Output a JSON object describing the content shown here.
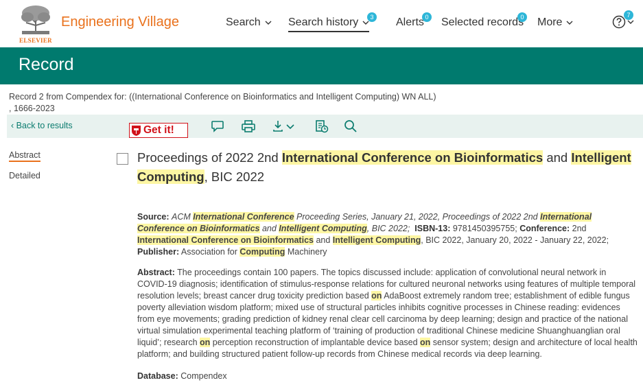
{
  "brand": {
    "logo_word": "ELSEVIER",
    "name": "Engineering Village",
    "color": "#e9711c"
  },
  "nav": {
    "search": "Search",
    "search_history": "Search history",
    "search_history_count": "3",
    "alerts": "Alerts",
    "alerts_count": "0",
    "selected_records": "Selected records",
    "selected_count": "0",
    "more": "More",
    "help_count": "7"
  },
  "band": {
    "title": "Record",
    "color": "#007a6e"
  },
  "record_info": {
    "line1": "Record 2 from Compendex for: ((International Conference on Bioinformatics and Intelligent Computing) WN ALL)",
    "line2": ", 1666-2023"
  },
  "toolbar": {
    "back": "Back to results",
    "getit": "Get it!",
    "icons": [
      "comment-icon",
      "print-icon",
      "download-icon",
      "save-to-folder-icon",
      "search-icon"
    ]
  },
  "side_tabs": {
    "abstract": "Abstract",
    "detailed": "Detailed"
  },
  "title_parts": {
    "t1": "Proceedings of 2022 2nd ",
    "t2": "International Conference on Bioinformatics",
    "t3": " and ",
    "t4": "Intelligent Computing",
    "t5": ", BIC 2022"
  },
  "source": {
    "label_source": "Source:",
    "s1": "ACM ",
    "s2": "International Conference",
    "s3": " Proceeding Series, January 21, 2022, ",
    "s4": "Proceedings of 2022 2nd ",
    "s5": "International Conference on Bioinformatics",
    "s6": " and ",
    "s7": "Intelligent Computing",
    "s8": ", BIC 2022;",
    "label_isbn": "ISBN-13:",
    "isbn": "9781450395755;",
    "label_conference": "Conference:",
    "c1": "2nd ",
    "c2": "International Conference on Bioinformatics",
    "c3": " and ",
    "c4": "Intelligent Computing",
    "c5": ", BIC 2022, January 20, 2022 - January 22, 2022;",
    "label_publisher": "Publisher:",
    "p1": "Association for ",
    "p2": "Computing",
    "p3": " Machinery"
  },
  "abstract": {
    "label": "Abstract:",
    "a1": "The proceedings contain 100 papers. The topics discussed include: application of convolutional neural network in COVID-19 diagnosis; identification of stimulus-response relations for cultured neuronal networks using features of multiple temporal resolution levels; breast cancer drug toxicity prediction based ",
    "on1": "on",
    "a2": " AdaBoost extremely random tree; establishment of edible fungus poverty alleviation wisdom platform; mixed use of structural particles inhibits cognitive processes in Chinese reading: evidences from eye movements; grading prediction of kidney renal clear cell carcinoma by deep learning; design and practice of the national virtual simulation experimental teaching platform of ‘training of production of traditional Chinese medicine Shuanghuanglian oral liquid’; research ",
    "on2": "on",
    "a3": " perception reconstruction of implantable device based ",
    "on3": "on",
    "a4": " sensor system; design and architecture of local health platform; and building structured patient follow-up records from Chinese medical records via deep learning."
  },
  "database": {
    "label": "Database:",
    "value": "Compendex"
  }
}
